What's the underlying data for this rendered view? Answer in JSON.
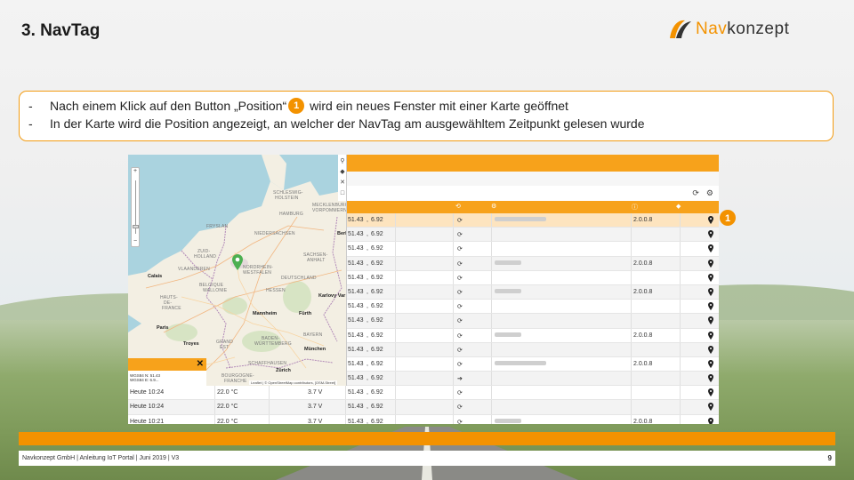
{
  "slide": {
    "title": "3. NavTag",
    "logo": {
      "part1": "Nav",
      "part2": "konzept"
    },
    "bullets": [
      {
        "dash": "-",
        "before": "Nach einem Klick auf den Button „Position“",
        "badge": "1",
        "after": " wird ein neues Fenster mit einer Karte geöffnet"
      },
      {
        "dash": "-",
        "text": "In der Karte wird die Position angezeigt, an welcher der NavTag am ausgewähltem Zeitpunkt gelesen wurde"
      }
    ],
    "callout_badge": "1",
    "footer": {
      "left": "Navkonzept GmbH  |  Anleitung IoT Portal  |  Juni 2019  |  V3",
      "page": "9"
    }
  },
  "map": {
    "labels": [
      {
        "t": "SCHLESWIG-",
        "cls": "lbl"
      },
      {
        "t": "HOLSTEIN",
        "cls": "lbl"
      },
      {
        "t": "HAMBURG",
        "cls": "lbl"
      },
      {
        "t": "MECKLENBURG-",
        "cls": "lbl"
      },
      {
        "t": "VORPOMMERN",
        "cls": "lbl"
      },
      {
        "t": "FRYSLAN",
        "cls": "lbl"
      },
      {
        "t": "NIEDERSACHSEN",
        "cls": "lbl"
      },
      {
        "t": "ZUID-",
        "cls": "lbl"
      },
      {
        "t": "HOLLAND",
        "cls": "lbl"
      },
      {
        "t": "SACHSEN-",
        "cls": "lbl"
      },
      {
        "t": "ANHALT",
        "cls": "lbl"
      },
      {
        "t": "NORDRHEIN-",
        "cls": "lbl"
      },
      {
        "t": "WESTFALEN",
        "cls": "lbl"
      },
      {
        "t": "VLAANDEREN",
        "cls": "lbl"
      },
      {
        "t": "DEUTSCHLAND",
        "cls": "lbl"
      },
      {
        "t": "BELGIQUE",
        "cls": "lbl"
      },
      {
        "t": "WALLONIE",
        "cls": "lbl"
      },
      {
        "t": "HESSEN",
        "cls": "lbl"
      },
      {
        "t": "HAUTS-",
        "cls": "lbl"
      },
      {
        "t": "DE-",
        "cls": "lbl"
      },
      {
        "t": "FRANCE",
        "cls": "lbl"
      },
      {
        "t": "GRAND",
        "cls": "lbl"
      },
      {
        "t": "EST",
        "cls": "lbl"
      },
      {
        "t": "BADEN-",
        "cls": "lbl"
      },
      {
        "t": "WÜRTTEMBERG",
        "cls": "lbl"
      },
      {
        "t": "BAYERN",
        "cls": "lbl"
      },
      {
        "t": "SCHAFFHAUSEN",
        "cls": "lbl"
      },
      {
        "t": "BOURGOGNE-",
        "cls": "lbl"
      },
      {
        "t": "FRANCHE",
        "cls": "lbl"
      },
      {
        "t": "Berlin",
        "cls": "city"
      },
      {
        "t": "Calais",
        "cls": "city"
      },
      {
        "t": "Paris",
        "cls": "city"
      },
      {
        "t": "Troyes",
        "cls": "city"
      },
      {
        "t": "Mannheim",
        "cls": "city"
      },
      {
        "t": "Fürth",
        "cls": "city"
      },
      {
        "t": "München",
        "cls": "city"
      },
      {
        "t": "Karlovy Var",
        "cls": "city"
      },
      {
        "t": "Zürich",
        "cls": "city"
      }
    ],
    "attribution": "Leaflet | © OpenStreetMap contributors, [OSM-Street]",
    "popup_lines": [
      "WGS84 N: 51.43",
      "WGS84 E: 6.9..."
    ],
    "tool_icons": [
      "magnifier-icon",
      "layers-icon",
      "fullscreen-icon",
      "square-icon"
    ]
  },
  "table": {
    "toolbar": {
      "refresh": "⟳",
      "settings": "⚙"
    },
    "header": [
      {
        "icon": "⟲"
      },
      {
        "icon": "⚙"
      },
      {
        "icon": "ⓘ"
      },
      {
        "icon": "◆"
      }
    ],
    "rows": [
      {
        "date": "",
        "temp": "",
        "volt": "",
        "coord": "51.43",
        "coord2": "6.92",
        "icon": "⟳",
        "info": true,
        "ver": "2.0.0.8"
      },
      {
        "date": "",
        "temp": "",
        "volt": "",
        "coord": "51.43",
        "coord2": "6.92",
        "icon": "⟳",
        "info": false,
        "ver": ""
      },
      {
        "date": "",
        "temp": "",
        "volt": "",
        "coord": "51.43",
        "coord2": "6.92",
        "icon": "⟳",
        "info": false,
        "ver": ""
      },
      {
        "date": "",
        "temp": "",
        "volt": "",
        "coord": "51.43",
        "coord2": "6.92",
        "icon": "⟳",
        "info": true,
        "ver": "2.0.0.8"
      },
      {
        "date": "",
        "temp": "",
        "volt": "",
        "coord": "51.43",
        "coord2": "6.92",
        "icon": "⟳",
        "info": false,
        "ver": ""
      },
      {
        "date": "",
        "temp": "",
        "volt": "",
        "coord": "51.43",
        "coord2": "6.92",
        "icon": "⟳",
        "info": true,
        "ver": "2.0.0.8"
      },
      {
        "date": "",
        "temp": "",
        "volt": "",
        "coord": "51.43",
        "coord2": "6.92",
        "icon": "⟳",
        "info": false,
        "ver": ""
      },
      {
        "date": "",
        "temp": "",
        "volt": "",
        "coord": "51.43",
        "coord2": "6.92",
        "icon": "⟳",
        "info": false,
        "ver": ""
      },
      {
        "date": "",
        "temp": "",
        "volt": "",
        "coord": "51.43",
        "coord2": "6.92",
        "icon": "⟳",
        "info": true,
        "ver": "2.0.0.8"
      },
      {
        "date": "",
        "temp": "",
        "volt": "",
        "coord": "51.43",
        "coord2": "6.92",
        "icon": "⟳",
        "info": false,
        "ver": ""
      },
      {
        "date": "",
        "temp": "",
        "volt": "",
        "coord": "51.43",
        "coord2": "6.92",
        "icon": "⟳",
        "info": true,
        "ver": "2.0.0.8"
      },
      {
        "date": "",
        "temp": "",
        "volt": "",
        "coord": "51.43",
        "coord2": "6.92",
        "icon": "➔",
        "info": false,
        "ver": ""
      },
      {
        "date": "Heute 10:24",
        "temp": "22.0 °C",
        "volt": "3.7 V",
        "coord": "51.43",
        "coord2": "6.92",
        "icon": "⟳",
        "info": false,
        "ver": ""
      },
      {
        "date": "Heute 10:24",
        "temp": "22.0 °C",
        "volt": "3.7 V",
        "coord": "51.43",
        "coord2": "6.92",
        "icon": "⟳",
        "info": false,
        "ver": ""
      },
      {
        "date": "Heute 10:21",
        "temp": "22.0 °C",
        "volt": "3.7 V",
        "coord": "51.43",
        "coord2": "6.92",
        "icon": "⟳",
        "info": true,
        "ver": "2.0.0.8"
      }
    ]
  },
  "colors": {
    "accent": "#f39200",
    "table_orange": "#f7a21b"
  }
}
